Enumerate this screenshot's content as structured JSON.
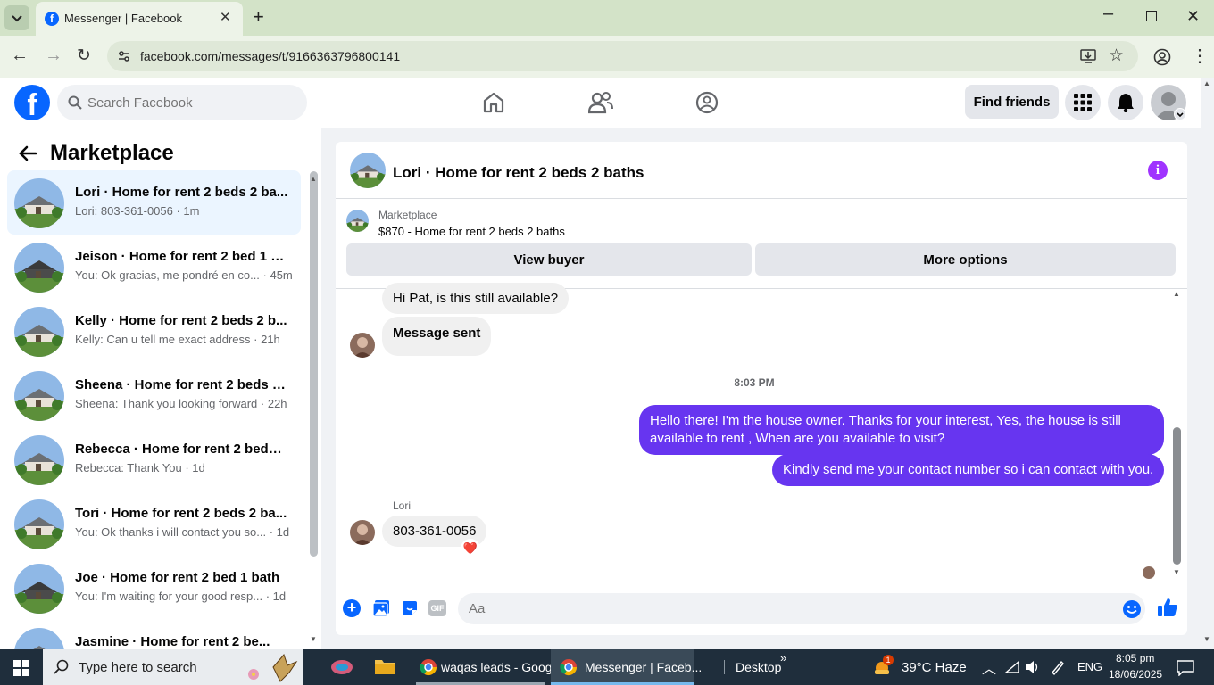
{
  "browser": {
    "tab_title": "Messenger | Facebook",
    "url": "facebook.com/messages/t/9166363796800141"
  },
  "fb_header": {
    "search_placeholder": "Search Facebook",
    "find_friends": "Find friends"
  },
  "sidebar": {
    "title": "Marketplace",
    "conversations": [
      {
        "name": "Lori · Home for rent 2 beds 2 ba...",
        "snippet": "Lori: 803-361-0056 · 1m",
        "active": true
      },
      {
        "name": "Jeison · Home for rent 2 bed 1 b...",
        "snippet": "You: Ok gracias, me pondré en co... · 45m",
        "active": false
      },
      {
        "name": "Kelly · Home for rent 2 beds 2 b...",
        "snippet": "Kelly: Can u tell me exact address · 21h",
        "active": false
      },
      {
        "name": "Sheena · Home for rent 2 beds 2...",
        "snippet": "Sheena: Thank you looking forward · 22h",
        "active": false
      },
      {
        "name": "Rebecca · Home for rent 2 beds ...",
        "snippet": "Rebecca: Thank You · 1d",
        "active": false
      },
      {
        "name": "Tori · Home for rent 2 beds 2 ba...",
        "snippet": "You: Ok thanks i will contact you so... · 1d",
        "active": false
      },
      {
        "name": "Joe · Home for rent 2 bed 1 bath",
        "snippet": "You: I'm waiting for your good resp... · 1d",
        "active": false
      },
      {
        "name": "Jasmine · Home for rent 2 be...",
        "snippet": "",
        "active": false
      }
    ]
  },
  "chat": {
    "title": "Lori · Home for rent 2 beds 2 baths",
    "listing_source": "Marketplace",
    "listing_name": "$870 - Home for rent 2 beds 2 baths",
    "view_buyer": "View buyer",
    "more_options": "More options",
    "messages": {
      "m1": "Hi Pat, is this still available?",
      "m2": "Message sent",
      "timestamp": "8:03 PM",
      "m3": "Hello there! I'm the house owner. Thanks for your interest, Yes, the house is still available to rent , When are you available to visit?",
      "m4": "Kindly send me your contact number so i can contact with you.",
      "sender": "Lori",
      "m5": "803-361-0056",
      "reaction": "❤️"
    },
    "composer_placeholder": "Aa",
    "gif_label": "GIF"
  },
  "taskbar": {
    "search": "Type here to search",
    "app1": "waqas leads - Goog...",
    "app2": "Messenger | Faceb...",
    "desktop": "Desktop",
    "weather": "39°C  Haze",
    "weather_badge": "1",
    "lang": "ENG",
    "time": "8:05 pm",
    "date": "18/06/2025"
  },
  "colors": {
    "facebook_blue": "#0866ff",
    "messenger_purple": "#6735f0",
    "info_purple": "#a033ff"
  }
}
